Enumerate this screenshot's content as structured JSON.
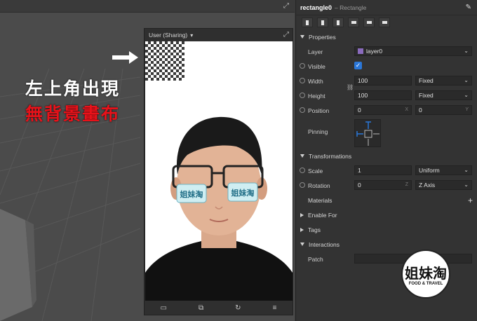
{
  "viewport": {
    "simulator_label": "User (Sharing)"
  },
  "caption": {
    "line1": "左上角出現",
    "line2": "無背景畫布"
  },
  "inspector": {
    "object_name": "rectangle0",
    "object_type": "– Rectangle",
    "properties_label": "Properties",
    "layer_label": "Layer",
    "layer_value": "layer0",
    "visible_label": "Visible",
    "width_label": "Width",
    "width_value": "100",
    "width_mode": "Fixed",
    "height_label": "Height",
    "height_value": "100",
    "height_mode": "Fixed",
    "position_label": "Position",
    "position_x": "0",
    "position_y": "0",
    "position_x_unit": "X",
    "position_y_unit": "Y",
    "pinning_label": "Pinning",
    "transformations_label": "Transformations",
    "scale_label": "Scale",
    "scale_value": "1",
    "scale_mode": "Uniform",
    "rotation_label": "Rotation",
    "rotation_value": "0",
    "rotation_unit": "Z",
    "rotation_axis": "Z Axis",
    "materials_label": "Materials",
    "enable_for_label": "Enable For",
    "tags_label": "Tags",
    "interactions_label": "Interactions",
    "patch_label": "Patch"
  },
  "watermark": {
    "main": "姐妹淘",
    "sub": "FOOD & TRAVEL"
  },
  "colors": {
    "accent_blue": "#2b77d8",
    "caption_red": "#e8121a",
    "layer_purple": "#8a6bbd"
  }
}
